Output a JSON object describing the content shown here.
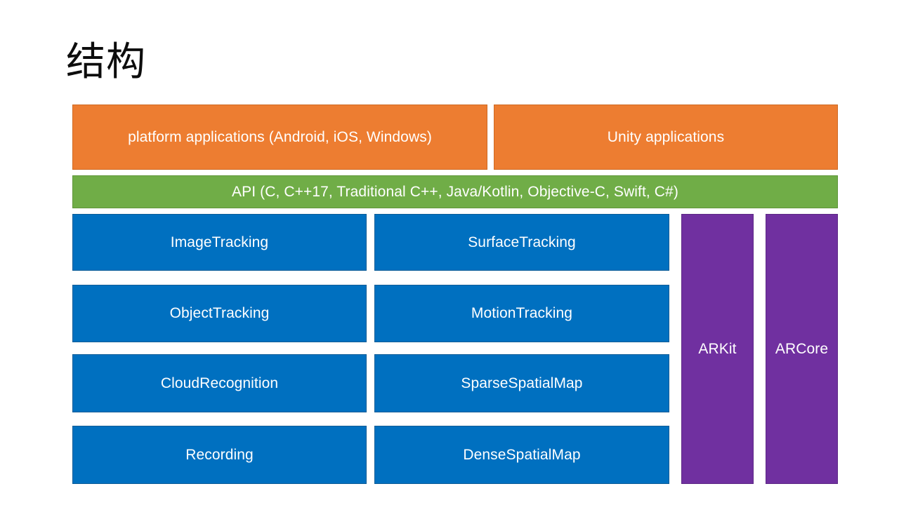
{
  "slide": {
    "title": "结构",
    "background_color": "#FFFFFF"
  },
  "colors": {
    "application_layer": "#ED7D31",
    "api_layer": "#70AD47",
    "feature_module": "#0070C0",
    "platform_sdk": "#7030A0",
    "text": "#FFFFFF",
    "title_text": "#0D0D0D"
  },
  "layers": {
    "applications": [
      {
        "label": "platform applications (Android, iOS, Windows)"
      },
      {
        "label": "Unity applications"
      }
    ],
    "api": {
      "label": "API (C, C++17, Traditional C++, Java/Kotlin, Objective-C, Swift, C#)"
    },
    "features": {
      "left_column": [
        {
          "label": "ImageTracking"
        },
        {
          "label": "ObjectTracking"
        },
        {
          "label": "CloudRecognition"
        },
        {
          "label": "Recording"
        }
      ],
      "right_column": [
        {
          "label": "SurfaceTracking"
        },
        {
          "label": "MotionTracking"
        },
        {
          "label": "SparseSpatialMap"
        },
        {
          "label": "DenseSpatialMap"
        }
      ]
    },
    "platform_sdks": [
      {
        "label": "ARKit"
      },
      {
        "label": "ARCore"
      }
    ]
  }
}
